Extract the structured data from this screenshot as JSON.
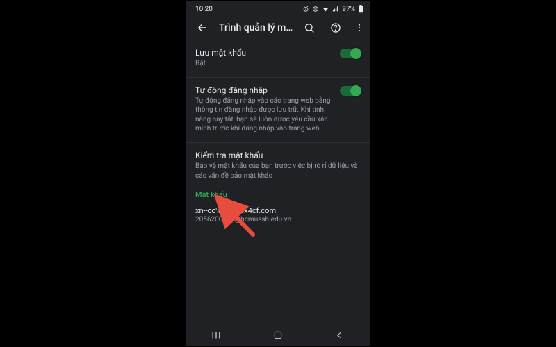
{
  "statusbar": {
    "time": "10:20",
    "battery_text": "97%"
  },
  "appbar": {
    "title": "Trình quản lý m…"
  },
  "save_passwords": {
    "title": "Lưu mật khẩu",
    "subtitle": "Bật",
    "on": true
  },
  "auto_signin": {
    "title": "Tự động đăng nhập",
    "subtitle": "Tự động đăng nhập vào các trang web bằng thông tin đăng nhập được lưu trữ. Khi tính năng này tắt, bạn sẽ luôn được yêu cầu xác minh trước khi đăng nhập vào trang web.",
    "on": true
  },
  "check_passwords": {
    "title": "Kiểm tra mật khẩu",
    "subtitle": "Bảo vệ mật khẩu của bạn trước việc bị rò rỉ dữ liệu và các vấn đề bảo mật khác"
  },
  "passwords_header": "Mật khẩu",
  "saved_entry": {
    "site": "xn--cc%20cc-8x4cf.com",
    "account": "2056200133@hcmussh.edu.vn"
  }
}
